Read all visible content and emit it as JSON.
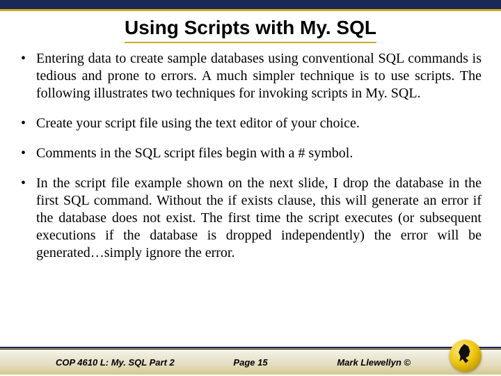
{
  "slide": {
    "title": "Using Scripts with My. SQL",
    "bullets": [
      "Entering data to create sample databases using conventional SQL commands is tedious and prone to errors.  A much simpler technique is to use scripts.  The following illustrates two techniques for invoking scripts in My. SQL.",
      "Create your script file using the text editor of your choice.",
      "Comments in the SQL script files begin with a  # symbol.",
      "In the script file example shown on the next slide, I drop the database in the first SQL command.  Without the if exists clause, this will generate an error if the database does not exist.  The first time the script executes (or subsequent executions if the database is dropped independently) the error will be generated…simply ignore the error."
    ]
  },
  "footer": {
    "course": "COP 4610 L: My. SQL Part 2",
    "page": "Page 15",
    "author": "Mark Llewellyn ©"
  },
  "logo": {
    "name": "ucf-pegasus-seal"
  }
}
